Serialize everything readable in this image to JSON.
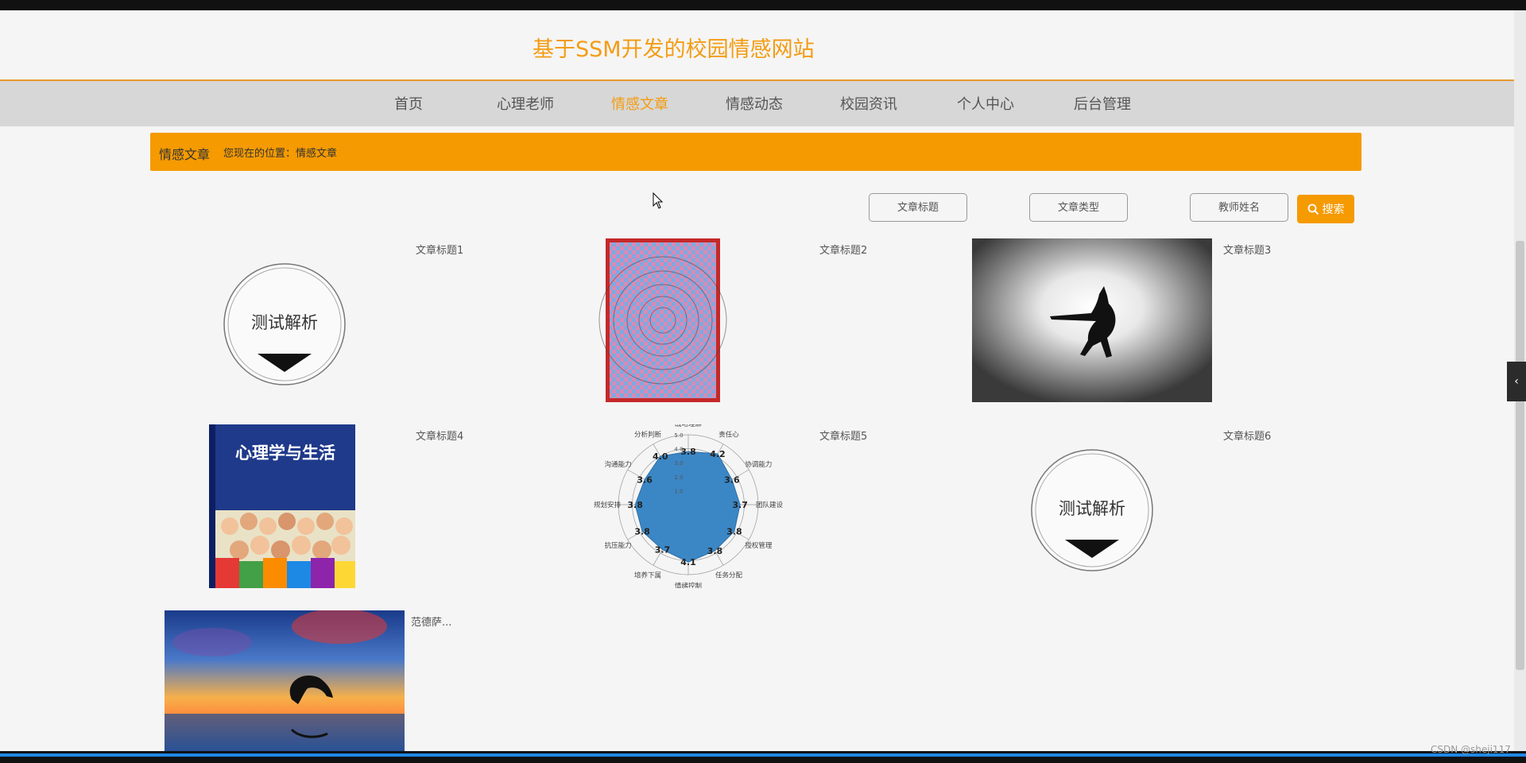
{
  "site": {
    "title": "基于SSM开发的校园情感网站"
  },
  "nav": {
    "items": [
      {
        "label": "首页"
      },
      {
        "label": "心理老师"
      },
      {
        "label": "情感文章"
      },
      {
        "label": "情感动态"
      },
      {
        "label": "校园资讯"
      },
      {
        "label": "个人中心"
      },
      {
        "label": "后台管理"
      }
    ],
    "active_index": 2
  },
  "breadcrumb": {
    "section": "情感文章",
    "location": "您现在的位置：情感文章"
  },
  "search": {
    "title_placeholder": "文章标题",
    "type_placeholder": "文章类型",
    "teacher_placeholder": "教师姓名",
    "button_label": "搜索"
  },
  "articles": [
    {
      "title": "文章标题1",
      "image_text": "测试解析"
    },
    {
      "title": "文章标题2"
    },
    {
      "title": "文章标题3"
    },
    {
      "title": "文章标题4",
      "image_text": "心理学与生活"
    },
    {
      "title": "文章标题5",
      "radar_labels": [
        "战略理解",
        "责任心",
        "协调能力",
        "团队建设",
        "授权管理",
        "任务分配",
        "情绪控制",
        "培养下属",
        "抗压能力",
        "规划安排",
        "沟通能力",
        "分析判断"
      ],
      "radar_values": [
        "3.8",
        "4.2",
        "3.6",
        "3.7",
        "3.8",
        "3.8",
        "4.1",
        "3.7",
        "3.8",
        "3.8",
        "3.6",
        "4.0"
      ],
      "radar_scale": [
        "5.0",
        "4.0",
        "3.0",
        "2.0",
        "1.0"
      ]
    },
    {
      "title": "文章标题6",
      "image_text": "测试解析"
    },
    {
      "title": "范德萨..."
    }
  ],
  "watermark": "CSDN @sheji117",
  "colors": {
    "accent": "#f39c12",
    "breadcrumb_bg": "#f59a00",
    "nav_bg": "#d7d7d7"
  }
}
